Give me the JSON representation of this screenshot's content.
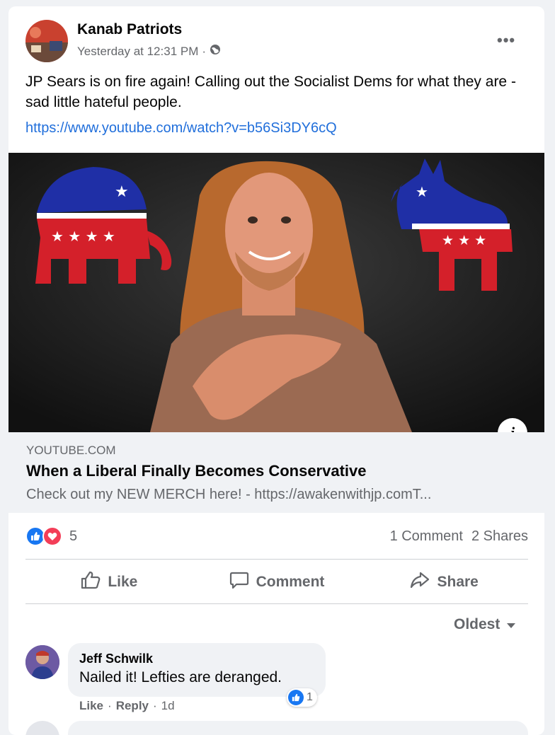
{
  "post": {
    "page_name": "Kanab Patriots",
    "timestamp": "Yesterday at 12:31 PM",
    "separator": "·",
    "audience_icon": "globe-icon",
    "more_icon": "•••",
    "text": "JP Sears is on fire again!  Calling out the Socialist Dems for what they are - sad little hateful people.",
    "link": "https://www.youtube.com/watch?v=b56Si3DY6cQ"
  },
  "preview": {
    "info_label": "i",
    "domain": "YOUTUBE.COM",
    "title": "When a Liberal Finally Becomes Conservative",
    "description": "Check out my NEW MERCH here! - https://awakenwithjp.comT..."
  },
  "reactions": {
    "icons": [
      "like-icon",
      "love-icon"
    ],
    "count": "5",
    "comments": "1 Comment",
    "shares": "2 Shares"
  },
  "actions": {
    "like": "Like",
    "comment": "Comment",
    "share": "Share"
  },
  "comments": {
    "sort_label": "Oldest",
    "items": [
      {
        "author": "Jeff Schwilk",
        "text": "Nailed it! Lefties are deranged.",
        "reaction_count": "1",
        "like": "Like",
        "reply": "Reply",
        "age": "1d"
      }
    ]
  },
  "colors": {
    "link": "#216fdb",
    "like_blue": "#1877f2",
    "love_red": "#f33e58",
    "gop_red": "#d4202a",
    "dem_blue": "#1f2fa6"
  }
}
